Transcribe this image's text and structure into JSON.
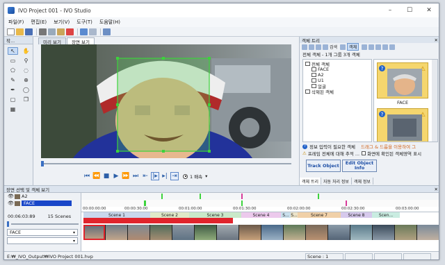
{
  "window": {
    "title": "IVO Project 001 - IVO Studio",
    "min": "–",
    "max": "☐",
    "close": "✕"
  },
  "menu": [
    "파일(F)",
    "편집(E)",
    "보기(V)",
    "도구(T)",
    "도움말(H)"
  ],
  "tool_panel": {
    "title": "작..."
  },
  "viewer": {
    "tabs": [
      "미리 보기",
      "장면 보기"
    ],
    "speed_label": "1 배속",
    "speed_arrow": "▾"
  },
  "object_tree": {
    "title": "객체 트리",
    "toolbar_labels": [
      "검색",
      "객체"
    ],
    "summary": "전체 객체 - 1개 그룹 3개 객체",
    "tree": [
      {
        "label": "전체 객체",
        "indent": 0
      },
      {
        "label": "FACE",
        "indent": 1
      },
      {
        "label": "A2",
        "indent": 1
      },
      {
        "label": "U1",
        "indent": 1
      },
      {
        "label": "얼굴",
        "indent": 1
      },
      {
        "label": "삭제된 객체",
        "indent": 0
      }
    ],
    "thumb_label": "FACE",
    "info_needed": "정보 입력이 필요한 객체",
    "drag_hint": "드래그 & 드롭을 이용하여 그",
    "track_whole": "프레임 전체에 대해 추적 ...",
    "display_check": "화면에 확인된 객체영역 표시",
    "track_button": "Track Object",
    "edit_button": "Edit Object Info",
    "bottom_tabs": [
      "객체 트리",
      "자동 처리 정보",
      "객체 정보"
    ]
  },
  "timeline": {
    "title": "장면 선택 및 객체 보기",
    "tracks": [
      "A2",
      "FACE"
    ],
    "timecode": "00:06:03:89",
    "scenes_count": "15 Scenes",
    "select_value": "FACE",
    "ruler": [
      "00:00:00:00",
      "00:00:30:00",
      "00:01:00:00",
      "00:01:30:00",
      "00:02:00:00",
      "00:02:30:00",
      "00:03:00:00"
    ],
    "scenes": [
      "Scene 1",
      "Scene 2",
      "Scene 3",
      "Scene 4",
      "S...",
      "S...",
      "Scene 7",
      "Scene 8",
      "Scen..."
    ]
  },
  "status": {
    "path": "E:₩_IVO_Output₩IVO Project 001.hvp",
    "scene": "Scene : 1"
  },
  "colors": {
    "accent": "#1846c8",
    "selection_red": "#e0242c",
    "thumb_yellow": "#f5d66e",
    "bbox_green": "#3cd33c"
  }
}
